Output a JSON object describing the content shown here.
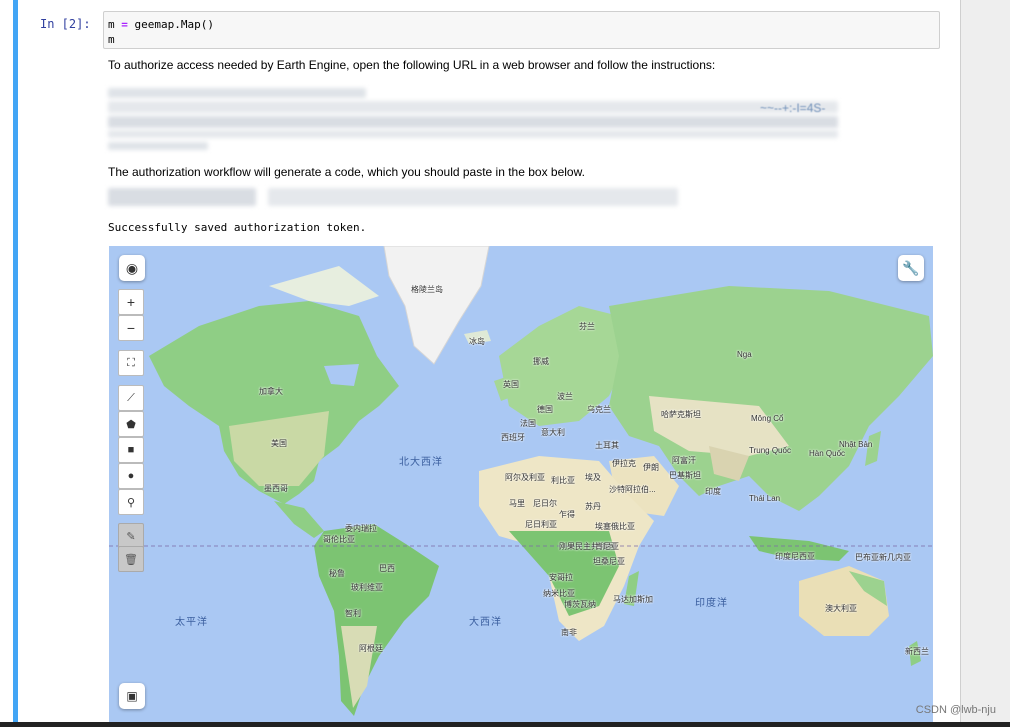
{
  "cell": {
    "prompt": "In  [2]:",
    "code_line1_var": "m",
    "code_line1_op": "=",
    "code_line1_call": "geemap.Map()",
    "code_line2": "m"
  },
  "output": {
    "authorize_text": "To authorize access needed by Earth Engine, open the following URL in a web browser and follow the instructions:",
    "url_fragment": "~~--+:-I=4S-",
    "workflow_text": "The authorization workflow will generate a code, which you should paste in the box below.",
    "success_text": "Successfully saved authorization token."
  },
  "map": {
    "labels": {
      "greenland": "格陵兰岛",
      "iceland": "冰岛",
      "finland": "芬兰",
      "norway": "挪威",
      "uk": "英国",
      "poland": "波兰",
      "germany": "德国",
      "ukraine": "乌克兰",
      "kazakhstan": "哈萨克斯坦",
      "mongolia": "Mông Cổ",
      "russia": "Nga",
      "canada": "加拿大",
      "usa": "美国",
      "mexico": "墨西哥",
      "france": "法国",
      "italy": "意大利",
      "spain": "西班牙",
      "turkey": "土耳其",
      "china": "Trung Quốc",
      "japan": "Nhật Bản",
      "korea": "Hàn Quốc",
      "iran": "伊朗",
      "afghanistan": "阿富汗",
      "pakistan": "巴基斯坦",
      "india": "印度",
      "thailand": "Thái Lan",
      "algeria": "阿尔及利亚",
      "libya": "利比亚",
      "egypt": "埃及",
      "iraq": "伊拉克",
      "saudi": "沙特阿拉伯...",
      "mali": "马里",
      "niger": "尼日尔",
      "chad": "乍得",
      "sudan": "苏丹",
      "nigeria": "尼日利亚",
      "ethiopia": "埃塞俄比亚",
      "venezuela": "委内瑞拉",
      "colombia": "哥伦比亚",
      "drc": "刚果民主共和国",
      "kenya": "肯尼亚",
      "tanzania": "坦桑尼亚",
      "peru": "秘鲁",
      "brazil": "巴西",
      "bolivia": "玻利维亚",
      "angola": "安哥拉",
      "namibia": "纳米比亚",
      "botswana": "博茨瓦纳",
      "madagascar": "马达加斯加",
      "chile": "智利",
      "south_africa": "南非",
      "argentina": "阿根廷",
      "indonesia": "印度尼西亚",
      "png": "巴布亚新几内亚",
      "australia": "澳大利亚",
      "new_zealand": "新西兰",
      "north_atlantic": "北大西洋",
      "pacific": "太平洋",
      "atlantic": "大西洋",
      "indian_ocean": "印度洋"
    },
    "controls": {
      "zoom_in": "+",
      "zoom_out": "−"
    }
  },
  "watermark": "CSDN @lwb-nju"
}
